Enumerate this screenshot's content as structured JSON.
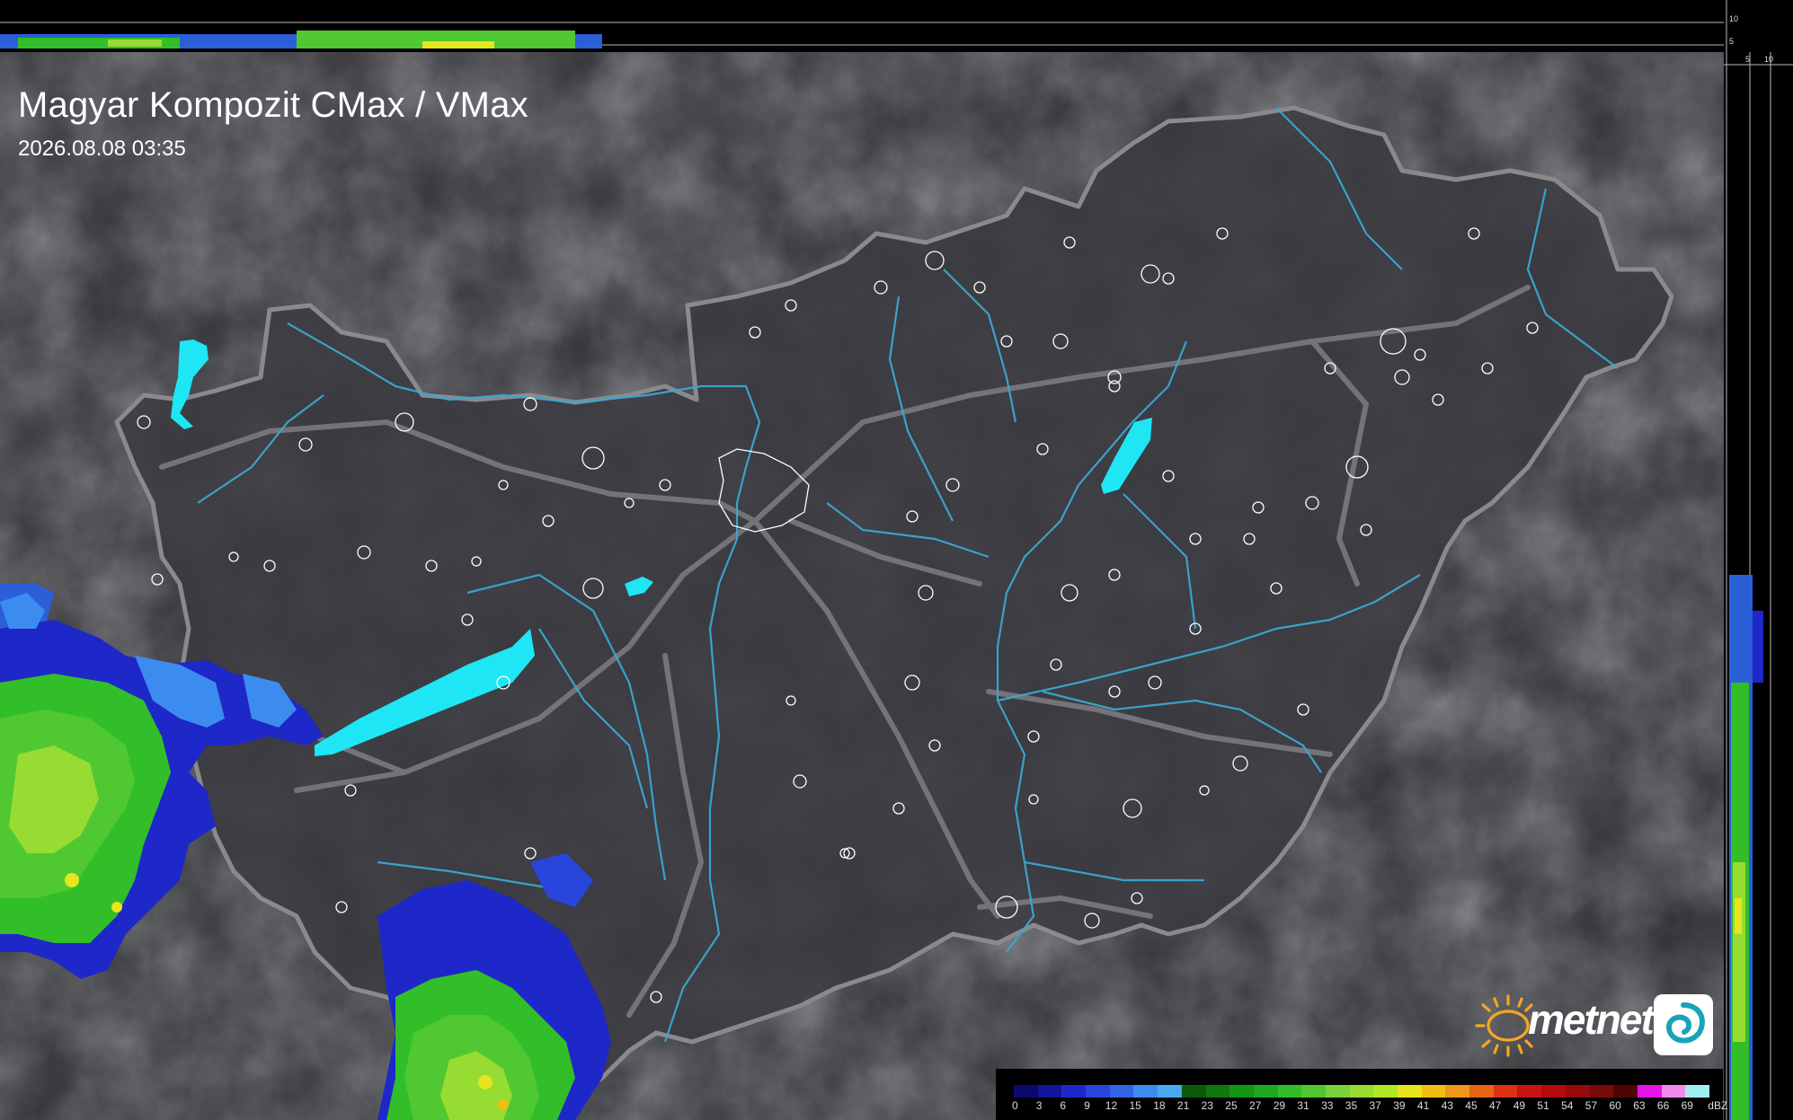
{
  "header": {
    "title": "Magyar Kompozit CMax / VMax",
    "timestamp": "2026.08.08 03:35"
  },
  "profile_axis": {
    "top_ticks": [
      "10",
      "5"
    ],
    "side_ticks": [
      "5",
      "10"
    ]
  },
  "brand": {
    "name": "metnet",
    "sun_color": "#f5a623"
  },
  "legend": {
    "unit": "dBZ",
    "labels": [
      "0",
      "3",
      "6",
      "9",
      "12",
      "15",
      "18",
      "21",
      "23",
      "25",
      "27",
      "29",
      "31",
      "33",
      "35",
      "37",
      "39",
      "41",
      "43",
      "45",
      "47",
      "49",
      "51",
      "54",
      "57",
      "60",
      "63",
      "66",
      "69"
    ],
    "colors": [
      "#0a0a6e",
      "#14149a",
      "#1e28c8",
      "#2846dc",
      "#3264e6",
      "#3c8cf0",
      "#46aaf5",
      "#0a5a0a",
      "#0f780f",
      "#149614",
      "#1eaa1e",
      "#32be28",
      "#50c832",
      "#78d23c",
      "#96dc32",
      "#b4e628",
      "#e6e61e",
      "#f0be14",
      "#f0961e",
      "#e66414",
      "#dc3214",
      "#c81414",
      "#b40a0a",
      "#960a0a",
      "#780a0a",
      "#500505",
      "#e614e6",
      "#f08cf0",
      "#a0f0f0"
    ]
  },
  "map_colors": {
    "terrain": "#2e2f33",
    "country_fill": "#3a3a3f",
    "border": "#8a8a8e",
    "river": "#3aa8d0",
    "lake": "#1ee6f5",
    "settlement": "#ffffff"
  }
}
